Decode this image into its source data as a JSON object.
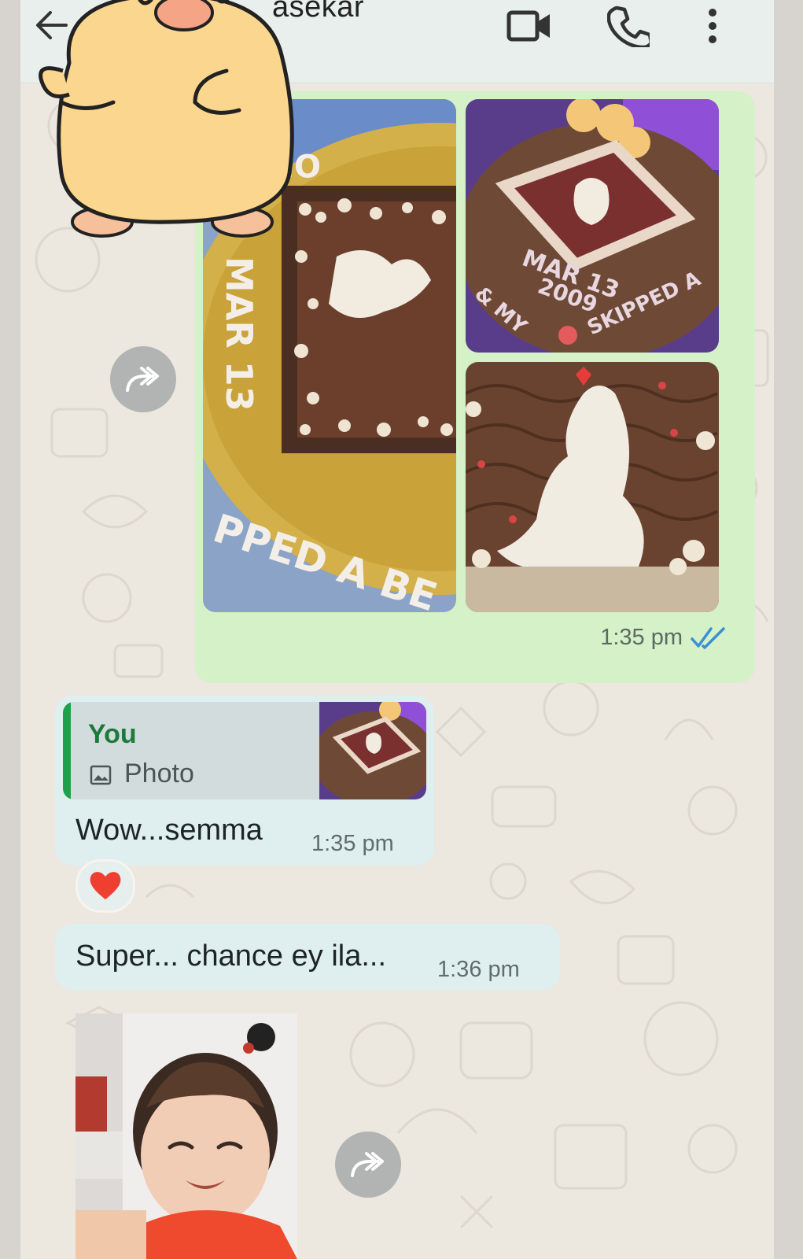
{
  "header": {
    "contact_name": "asekar",
    "back_icon": "arrow-left-icon",
    "video_icon": "video-camera-icon",
    "call_icon": "phone-icon",
    "menu_icon": "more-vert-icon"
  },
  "messages": [
    {
      "kind": "photo-album",
      "direction": "outgoing",
      "time": "1:35 pm",
      "status": "read",
      "cake_text": {
        "left_top": "ONE",
        "left_date": "MAR 13",
        "left_bottom": "PPED A BE",
        "right_date": "MAR 13",
        "right_year": "2009",
        "right_bottom": "SKIPPED A",
        "right_left": "& MY"
      }
    },
    {
      "kind": "reply",
      "direction": "incoming",
      "quote_author": "You",
      "quote_type": "Photo",
      "text": "Wow...semma",
      "time": "1:35 pm",
      "reaction": "heart"
    },
    {
      "kind": "text",
      "direction": "incoming",
      "text": "Super... chance ey ila...",
      "time": "1:36 pm"
    },
    {
      "kind": "photo",
      "direction": "incoming"
    }
  ],
  "colors": {
    "outgoing_bubble": "#d4f1c7",
    "incoming_bubble": "#dfeeef",
    "read_ticks": "#3b8fd6",
    "quote_accent": "#1da14a"
  }
}
